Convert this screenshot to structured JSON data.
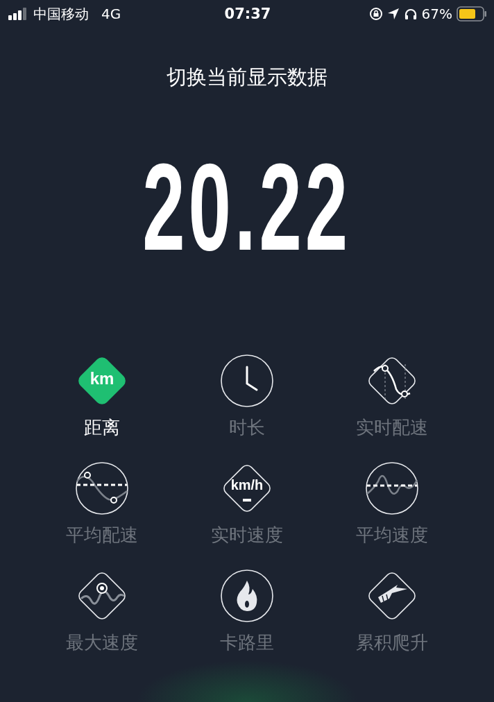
{
  "status_bar": {
    "carrier": "中国移动",
    "network": "4G",
    "time": "07:37",
    "battery_percent": "67%"
  },
  "title": "切换当前显示数据",
  "value": "20.22",
  "metrics": [
    {
      "label": "距离",
      "kind": "unit-diamond",
      "unit": "km",
      "selected": true
    },
    {
      "label": "时长",
      "kind": "clock",
      "selected": false
    },
    {
      "label": "实时配速",
      "kind": "pace-diamond",
      "selected": false
    },
    {
      "label": "平均配速",
      "kind": "avg-pace-circle",
      "selected": false
    },
    {
      "label": "实时速度",
      "kind": "unit-diamond",
      "unit": "km/h",
      "selected": false
    },
    {
      "label": "平均速度",
      "kind": "avg-speed-circle",
      "selected": false
    },
    {
      "label": "最大速度",
      "kind": "max-speed-diamond",
      "selected": false
    },
    {
      "label": "卡路里",
      "kind": "flame-circle",
      "selected": false
    },
    {
      "label": "累积爬升",
      "kind": "climb-diamond",
      "selected": false
    }
  ]
}
